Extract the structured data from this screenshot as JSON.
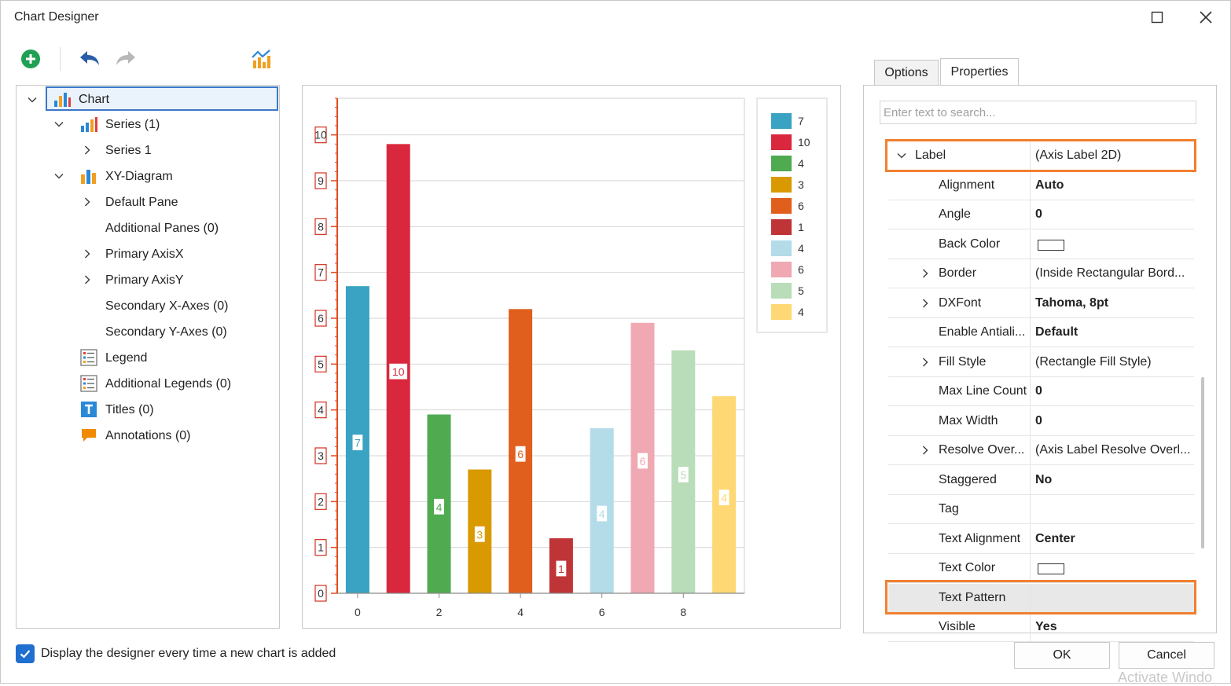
{
  "window": {
    "title": "Chart Designer"
  },
  "toolbar": {
    "add": "add-icon",
    "undo": "undo-icon",
    "redo": "redo-icon",
    "wizard": "chart-wizard-icon"
  },
  "tree": {
    "items": [
      {
        "label": "Chart",
        "indent": 0,
        "expanded": true,
        "icon": "bar-chart-icon",
        "selected": true
      },
      {
        "label": "Series (1)",
        "indent": 1,
        "expanded": true,
        "icon": "series-icon"
      },
      {
        "label": "Series 1",
        "indent": 2,
        "expanded": false
      },
      {
        "label": "XY-Diagram",
        "indent": 1,
        "expanded": true,
        "icon": "diagram-icon"
      },
      {
        "label": "Default Pane",
        "indent": 2,
        "expanded": false
      },
      {
        "label": "Additional Panes (0)",
        "indent": 2
      },
      {
        "label": "Primary AxisX",
        "indent": 2,
        "expanded": false
      },
      {
        "label": "Primary AxisY",
        "indent": 2,
        "expanded": false
      },
      {
        "label": "Secondary X-Axes (0)",
        "indent": 2
      },
      {
        "label": "Secondary Y-Axes (0)",
        "indent": 2
      },
      {
        "label": "Legend",
        "indent": 1,
        "icon": "legend-icon"
      },
      {
        "label": "Additional Legends (0)",
        "indent": 1,
        "icon": "legend-icon"
      },
      {
        "label": "Titles (0)",
        "indent": 1,
        "icon": "title-icon"
      },
      {
        "label": "Annotations (0)",
        "indent": 1,
        "icon": "annotation-icon"
      }
    ]
  },
  "tabs": [
    {
      "label": "Options",
      "active": false
    },
    {
      "label": "Properties",
      "active": true
    }
  ],
  "search": {
    "placeholder": "Enter text to search..."
  },
  "properties": [
    {
      "name": "Label",
      "value": "(Axis Label 2D)",
      "bold": false,
      "expandable": true,
      "expanded": true,
      "level": 0
    },
    {
      "name": "Alignment",
      "value": "Auto",
      "bold": true
    },
    {
      "name": "Angle",
      "value": "0",
      "bold": true
    },
    {
      "name": "Back Color",
      "value": "",
      "swatch": true
    },
    {
      "name": "Border",
      "value": "(Inside Rectangular Bord...",
      "expandable": true
    },
    {
      "name": "DXFont",
      "value": "Tahoma, 8pt",
      "bold": true,
      "expandable": true
    },
    {
      "name": "Enable Antiali...",
      "value": "Default",
      "bold": true
    },
    {
      "name": "Fill Style",
      "value": "(Rectangle Fill Style)",
      "expandable": true
    },
    {
      "name": "Max Line Count",
      "value": "0",
      "bold": true
    },
    {
      "name": "Max Width",
      "value": "0",
      "bold": true
    },
    {
      "name": "Resolve Over...",
      "value": "(Axis Label Resolve Overl...",
      "expandable": true
    },
    {
      "name": "Staggered",
      "value": "No",
      "bold": true
    },
    {
      "name": "Tag",
      "value": ""
    },
    {
      "name": "Text Alignment",
      "value": "Center",
      "bold": true
    },
    {
      "name": "Text Color",
      "value": "",
      "swatch": true
    },
    {
      "name": "Text Pattern",
      "value": "",
      "selected": true
    },
    {
      "name": "Visible",
      "value": "Yes",
      "bold": true
    }
  ],
  "footer": {
    "checkbox_label": "Display the designer every time a new chart is added",
    "checked": true,
    "ok": "OK",
    "cancel": "Cancel",
    "watermark": "Activate Windo"
  },
  "chart_data": {
    "type": "bar",
    "x": [
      0,
      1,
      2,
      3,
      4,
      5,
      6,
      7,
      8,
      9
    ],
    "values": [
      6.7,
      9.8,
      3.9,
      2.7,
      6.2,
      1.2,
      3.6,
      5.9,
      5.3,
      4.3
    ],
    "point_labels": [
      "7",
      "10",
      "4",
      "3",
      "6",
      "1",
      "4",
      "6",
      "5",
      "4"
    ],
    "colors": [
      "#3aa2c2",
      "#d9273d",
      "#4faa50",
      "#d89a00",
      "#e05f1c",
      "#bf3437",
      "#b3dce8",
      "#f0a8b2",
      "#b8ddb8",
      "#fed874"
    ],
    "x_ticks": [
      "0",
      "2",
      "4",
      "6",
      "8"
    ],
    "y_ticks": [
      "0",
      "1",
      "2",
      "3",
      "4",
      "5",
      "6",
      "7",
      "8",
      "9",
      "10"
    ],
    "ylim": [
      0,
      10.8
    ],
    "xlim": [
      -0.5,
      9.5
    ],
    "grid": true,
    "legend_position": "top-right",
    "legend": [
      "7",
      "10",
      "4",
      "3",
      "6",
      "1",
      "4",
      "6",
      "5",
      "4"
    ]
  }
}
